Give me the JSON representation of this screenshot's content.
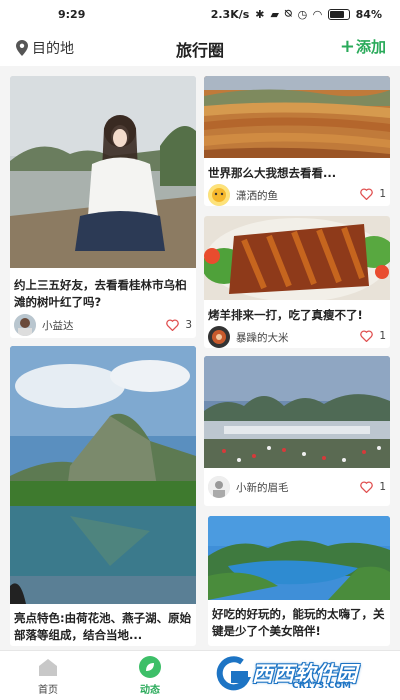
{
  "status_bar": {
    "time": "9:29",
    "network_speed": "2.3K/s",
    "battery_percent": "84",
    "battery_level": 0.84,
    "icons": [
      "bluetooth-icon",
      "signal-icon",
      "mute-icon",
      "alarm-icon",
      "wifi-icon",
      "battery-icon"
    ]
  },
  "header": {
    "destination_label": "目的地",
    "title": "旅行圈",
    "add_label": "添加",
    "accent_color": "#2aaa5a"
  },
  "feed": {
    "posts": [
      {
        "title": "约上三五好友，去看看桂林市乌桕滩的树叶红了吗?",
        "author": "小益达",
        "likes": "3"
      },
      {
        "title": "世界那么大我想去看看...",
        "author": "潇洒的鱼",
        "likes": "1"
      },
      {
        "title": "烤羊排来一打，吃了真瘦不了!",
        "author": "暴躁的大米",
        "likes": "1"
      },
      {
        "title": "亮点特色:由荷花池、燕子湖、原始部落等组成，结合当地...",
        "author": "",
        "likes": ""
      },
      {
        "title": "",
        "author": "小新的眉毛",
        "likes": "1"
      },
      {
        "title": "好吃的好玩的，能玩的太嗨了，关键是少了个美女陪伴!",
        "author": "",
        "likes": ""
      }
    ]
  },
  "tabbar": {
    "tabs": [
      {
        "label": "首页",
        "icon": "home-icon"
      },
      {
        "label": "动态",
        "icon": "leaf-icon",
        "active": true
      }
    ]
  },
  "watermark": {
    "text": "西西软件园",
    "url": "CR173.COM"
  }
}
